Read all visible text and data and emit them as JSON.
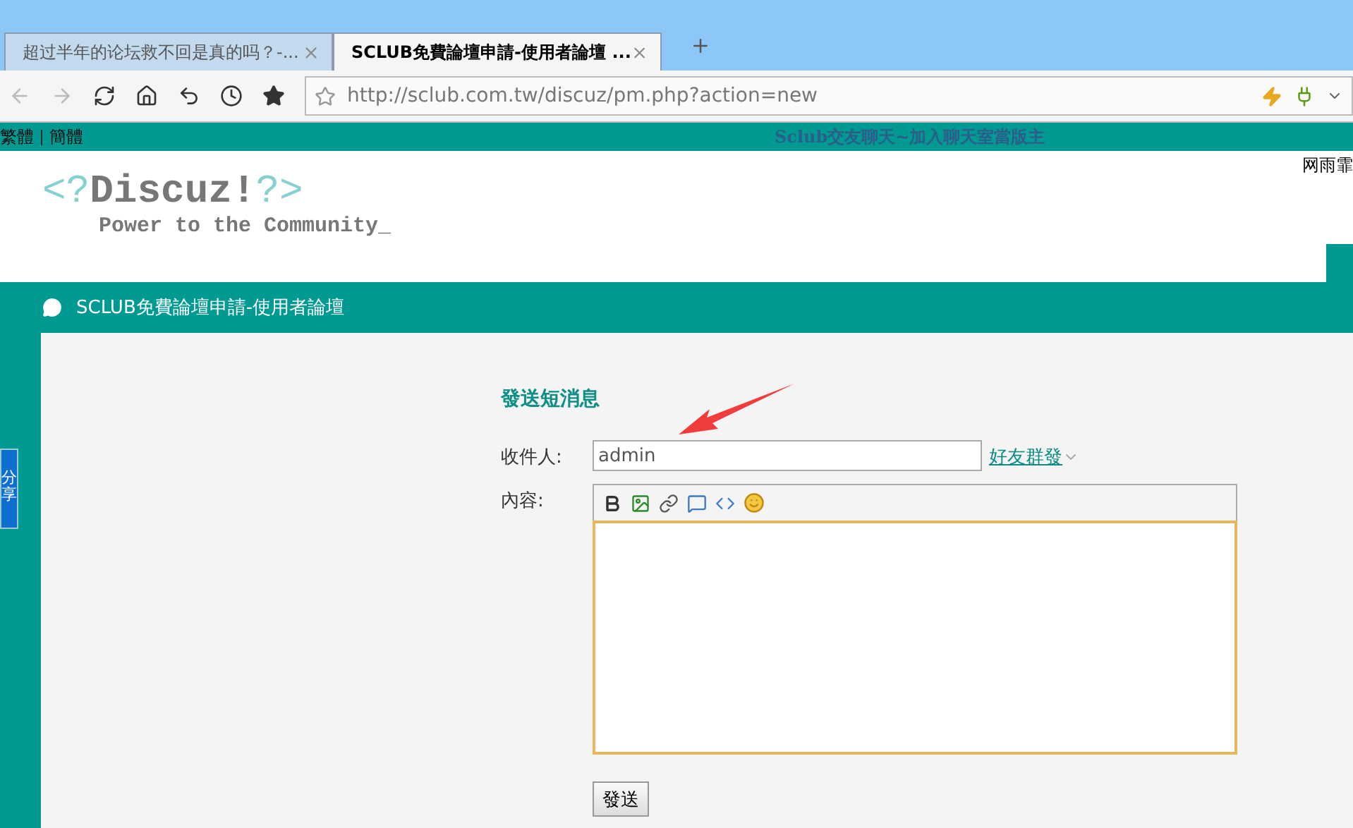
{
  "browser": {
    "tabs": [
      {
        "title": "超过半年的论坛救不回是真的吗？-...",
        "selected": false
      },
      {
        "title": "SCLUB免費論壇申請-使用者論壇 ...",
        "selected": true
      }
    ],
    "url": "http://sclub.com.tw/discuz/pm.php?action=new"
  },
  "topbar": {
    "languages": [
      "繁體",
      "簡體"
    ],
    "marquee": "Sclub交友聊天~加入聊天室當版主"
  },
  "header": {
    "logo_open": "<?",
    "logo_title": "Discuz!",
    "logo_close": "?>",
    "logo_tagline": "Power to the Community_",
    "corner_text": "网雨霏"
  },
  "forum_bar": {
    "title": "SCLUB免費論壇申請-使用者論壇"
  },
  "share_widget": {
    "label": "分享"
  },
  "form": {
    "title": "發送短消息",
    "recipient_label": "收件人:",
    "recipient_value": "admin",
    "friends_link": "好友群發",
    "content_label": "內容:",
    "submit": "發送"
  }
}
